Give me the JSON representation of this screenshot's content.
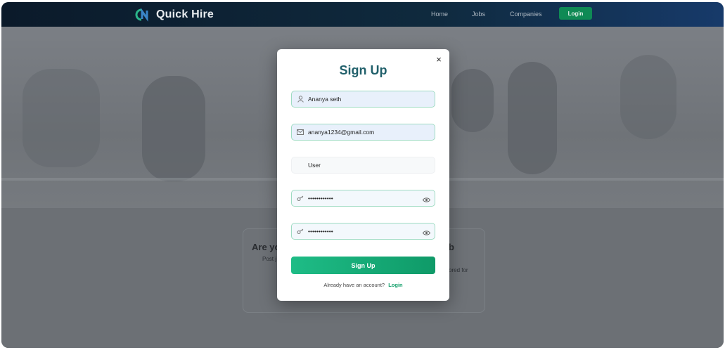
{
  "navbar": {
    "brand": "Quick Hire",
    "links": [
      "Home",
      "Jobs",
      "Companies"
    ],
    "login_label": "Login"
  },
  "background": {
    "heading_left": "Are yo",
    "heading_right": "b",
    "sub_left": "Post j",
    "sub_right": "ored for"
  },
  "modal": {
    "title": "Sign Up",
    "close_icon": "×",
    "name_value": "Ananya seth",
    "email_value": "ananya1234@gmail.com",
    "role_value": "User",
    "password_value": "••••••••••••",
    "confirm_password_value": "••••••••••••",
    "submit_label": "Sign Up",
    "footer_text": "Already have an account?",
    "footer_link": "Login"
  },
  "colors": {
    "accent": "#14a06c",
    "title": "#21606b",
    "navbar": "#0f2a3e"
  },
  "icons": {
    "name_field": "user-icon",
    "email_field": "mail-icon",
    "password_field": "key-icon",
    "visibility": "eye-icon",
    "close": "close-icon"
  }
}
